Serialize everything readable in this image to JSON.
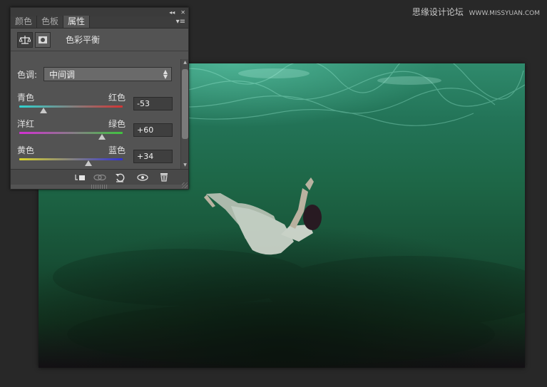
{
  "watermark": {
    "main": "思缘设计论坛",
    "sub": "WWW.MISSYUAN.COM"
  },
  "panel": {
    "top_controls": {
      "collapse": "◂◂",
      "close": "✕"
    },
    "tabs": [
      {
        "label": "颜色",
        "active": false
      },
      {
        "label": "色板",
        "active": false
      },
      {
        "label": "属性",
        "active": true
      }
    ],
    "title": "色彩平衡",
    "tone": {
      "label": "色调:",
      "value": "中间调"
    },
    "sliders": [
      {
        "left": "青色",
        "right": "红色",
        "value": "-53",
        "level": -53,
        "colors": [
          "#2fd3d0",
          "#d23434"
        ]
      },
      {
        "left": "洋红",
        "right": "绿色",
        "value": "+60",
        "level": 60,
        "colors": [
          "#d42fd4",
          "#3fc43f"
        ]
      },
      {
        "left": "黄色",
        "right": "蓝色",
        "value": "+34",
        "level": 34,
        "colors": [
          "#d9d42b",
          "#3232d4"
        ]
      }
    ]
  },
  "colors": {
    "panel_bg": "#535353",
    "canvas_bg": "#282828",
    "water": "#1d6646"
  }
}
